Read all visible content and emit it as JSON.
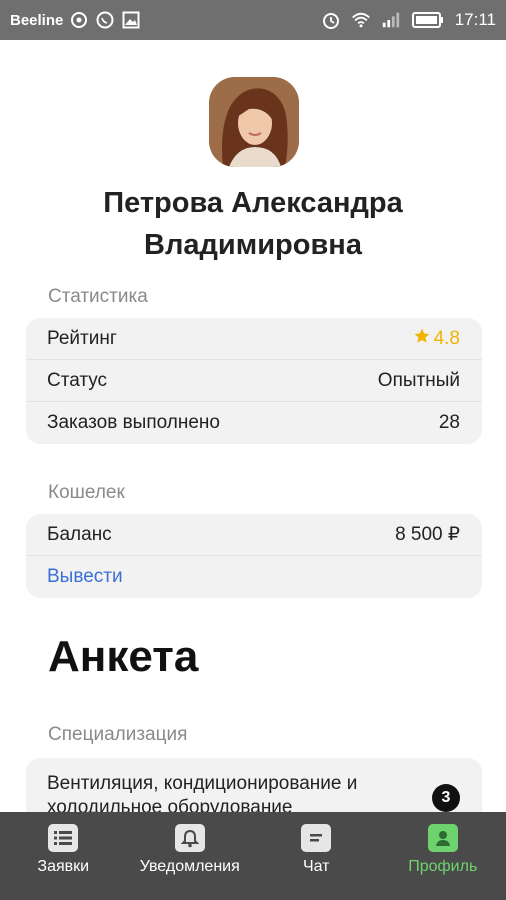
{
  "status_bar": {
    "carrier": "Beeline",
    "time": "17:11"
  },
  "profile": {
    "name": "Петрова Александра Владимировна"
  },
  "statistics": {
    "label": "Статистика",
    "rows": [
      {
        "label": "Рейтинг",
        "value": "4.8"
      },
      {
        "label": "Статус",
        "value": "Опытный"
      },
      {
        "label": "Заказов выполнено",
        "value": "28"
      }
    ]
  },
  "wallet": {
    "label": "Кошелек",
    "balance_label": "Баланс",
    "balance_value": "8 500 ₽",
    "withdraw_label": "Вывести"
  },
  "questionnaire": {
    "title": "Анкета",
    "specialization_label": "Специализация",
    "specialization_text": "Вентиляция, кондиционирование и холодильное оборудование",
    "specialization_count": "3"
  },
  "bottom_nav": {
    "items": [
      {
        "label": "Заявки",
        "icon": "list-icon"
      },
      {
        "label": "Уведомления",
        "icon": "bell-icon"
      },
      {
        "label": "Чат",
        "icon": "chat-icon"
      },
      {
        "label": "Профиль",
        "icon": "profile-icon"
      }
    ],
    "active": "Профиль"
  },
  "colors": {
    "rating": "#f0b400",
    "link": "#3b6fd6",
    "active_nav": "#6ed36e",
    "nav_bg": "#4a4a4a"
  }
}
